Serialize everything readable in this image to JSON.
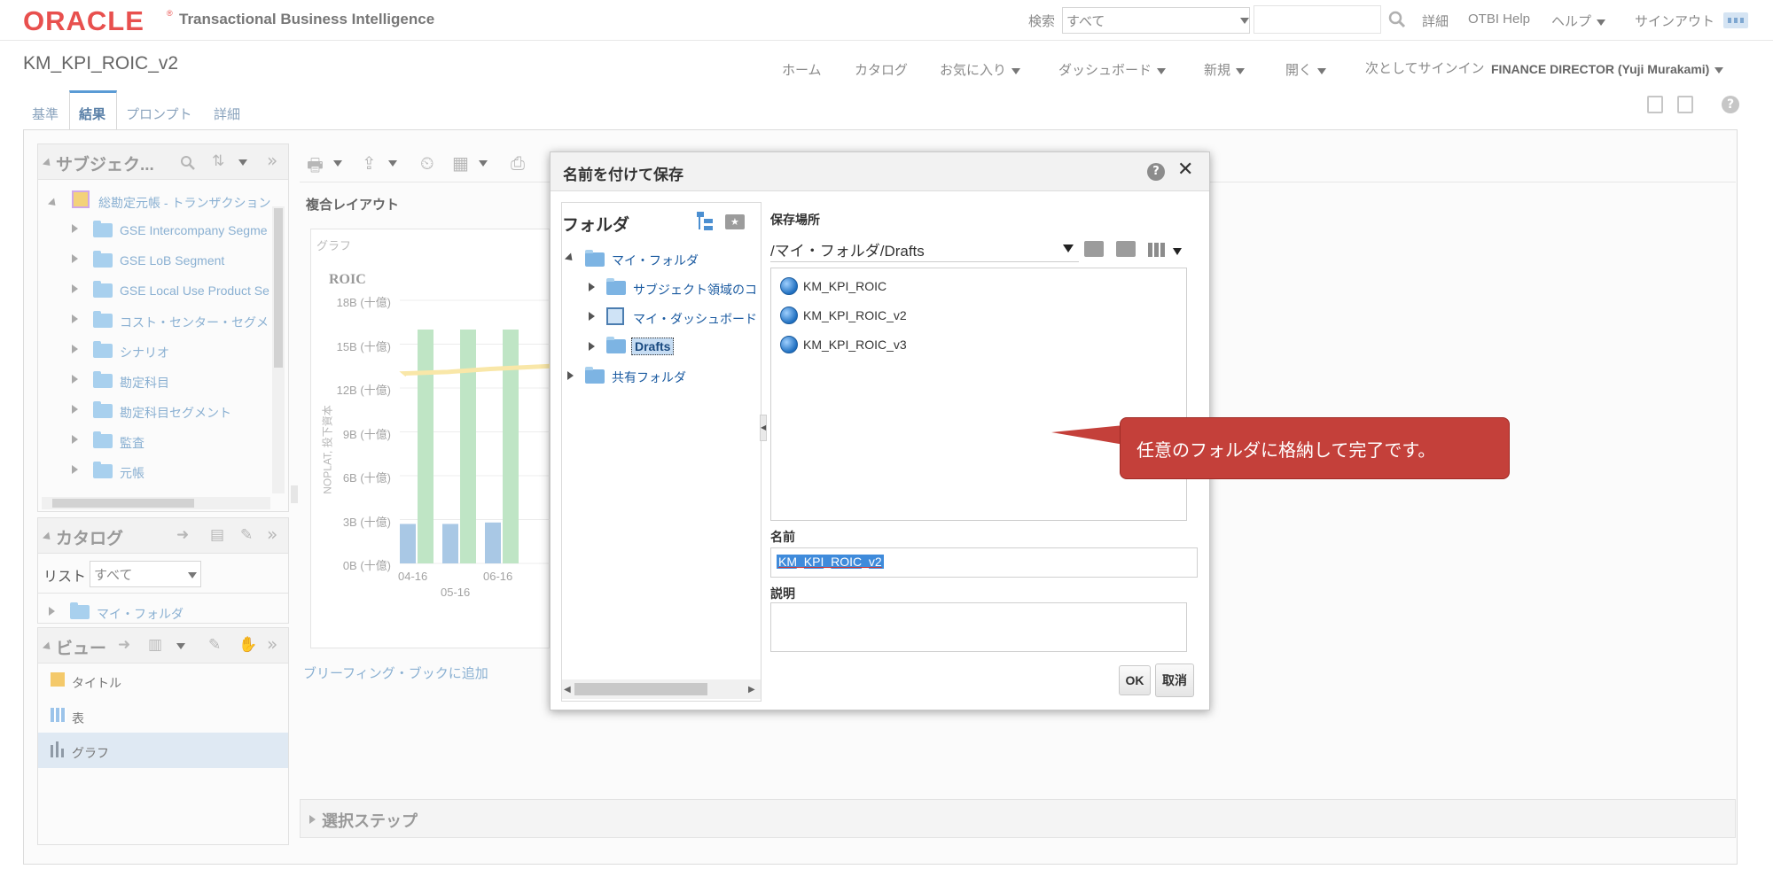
{
  "header": {
    "logo": "ORACLE",
    "logo_mark": "®",
    "product": "Transactional Business Intelligence",
    "search_label": "検索",
    "search_scope": "すべて",
    "search_input": "",
    "links": {
      "details": "詳細",
      "otbi_help": "OTBI Help",
      "help": "ヘルプ",
      "signout": "サインアウト"
    }
  },
  "nav": {
    "page_title": "KM_KPI_ROIC_v2",
    "home": "ホーム",
    "catalog": "カタログ",
    "favorites": "お気に入り",
    "dashboard": "ダッシュボード",
    "new": "新規",
    "open": "開く",
    "signin_as": "次としてサインイン",
    "user": "FINANCE DIRECTOR (Yuji Murakami)"
  },
  "tabs": [
    "基準",
    "結果",
    "プロンプト",
    "詳細"
  ],
  "subject_pane": {
    "title": "サブジェク...",
    "root": "総勘定元帳 - トランザクション",
    "items": [
      "GSE Intercompany Segme",
      "GSE LoB Segment",
      "GSE Local Use Product Se",
      "コスト・センター・セグメ",
      "シナリオ",
      "勘定科目",
      "勘定科目セグメント",
      "監査",
      "元帳"
    ]
  },
  "catalog_pane": {
    "title": "カタログ",
    "list_label": "リスト",
    "list_value": "すべて",
    "folder": "マイ・フォルダ"
  },
  "views_pane": {
    "title": "ビュー",
    "items": [
      "タイトル",
      "表",
      "グラフ"
    ]
  },
  "layout": {
    "compound_layout": "複合レイアウト",
    "graph_label": "グラフ",
    "briefing_link": "ブリーフィング・ブックに追加",
    "selection_steps": "選択ステップ"
  },
  "chart_data": {
    "type": "bar",
    "title": "ROIC",
    "ylabel": "NOPLAT, 投下資本",
    "y_ticks": [
      "18B (十億)",
      "15B (十億)",
      "12B (十億)",
      "9B (十億)",
      "6B (十億)",
      "3B (十億)",
      "0B (十億)"
    ],
    "ylim": [
      0,
      18
    ],
    "categories": [
      "04-16",
      "05-16",
      "06-16"
    ],
    "series": [
      {
        "values": [
          2.7,
          2.7,
          2.8
        ]
      },
      {
        "values": [
          16,
          16,
          16
        ]
      }
    ],
    "line_values": [
      13,
      13.1,
      13.3
    ],
    "colors": {
      "blue": "#a9c8e5",
      "green": "#bfe5c5",
      "line": "#f9e7a8"
    }
  },
  "dialog": {
    "title": "名前を付けて保存",
    "folders_title": "フォルダ",
    "tree": {
      "my_folder": "マイ・フォルダ",
      "children": [
        "サブジェクト領域のコ",
        "マイ・ダッシュボード",
        "Drafts"
      ],
      "shared": "共有フォルダ"
    },
    "location_label": "保存場所",
    "location_value": "/マイ・フォルダ/Drafts",
    "files": [
      "KM_KPI_ROIC",
      "KM_KPI_ROIC_v2",
      "KM_KPI_ROIC_v3"
    ],
    "name_label": "名前",
    "name_value": "KM_KPI_ROIC_v2",
    "desc_label": "説明",
    "desc_value": "",
    "ok": "OK",
    "cancel": "取消"
  },
  "callout": "任意のフォルダに格納して完了です。"
}
